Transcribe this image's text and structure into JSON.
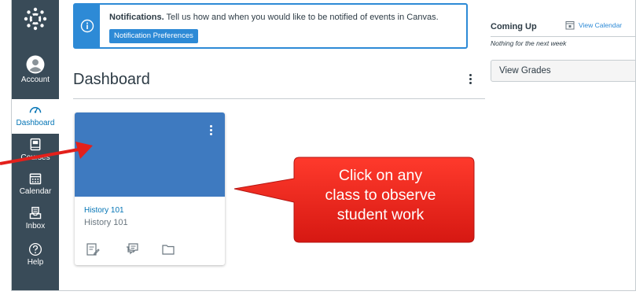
{
  "nav": {
    "account": "Account",
    "dashboard": "Dashboard",
    "courses": "Courses",
    "calendar": "Calendar",
    "inbox": "Inbox",
    "help": "Help"
  },
  "banner": {
    "title": "Notifications.",
    "message": " Tell us how and when you would like to be notified of events in Canvas.",
    "button": "Notification Preferences"
  },
  "dashboard": {
    "title": "Dashboard"
  },
  "course_card": {
    "title": "History 101",
    "subtitle": "History 101"
  },
  "sidebar": {
    "coming_up": "Coming Up",
    "view_calendar": "View Calendar",
    "nothing": "Nothing for the next week",
    "view_grades": "View Grades"
  },
  "annotation": {
    "line1": "Click on any",
    "line2": "class to observe",
    "line3": "student work"
  },
  "colors": {
    "nav_bg": "#394b58",
    "brand_blue": "#2d8ad6",
    "card_blue": "#3e7ac0",
    "callout_red": "#e3201b"
  }
}
